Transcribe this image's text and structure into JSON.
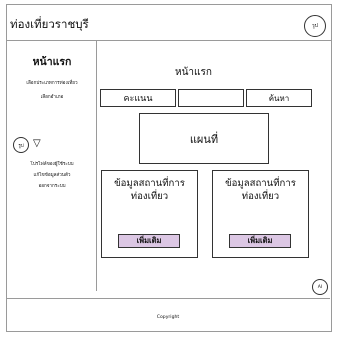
{
  "header": {
    "site_title": "ท่องเที่ยวราชบุรี",
    "avatar_label": "รูป"
  },
  "sidebar": {
    "title": "หน้าแรก",
    "lines": [
      "เลือกประเภทการท่องเที่ยว",
      "เลือกอำเภอ"
    ],
    "avatar_label": "รูป",
    "menu": [
      "โปรไฟล์ของผู้ใช้ระบบ",
      "แก้ไขข้อมูลส่วนตัว",
      "ออกจากระบบ"
    ]
  },
  "main": {
    "title": "หน้าแรก",
    "score_label": "คะแนน",
    "search_value": "",
    "search_button": "ค้นหา",
    "map_label": "แผนที่",
    "cards": [
      {
        "title_line1": "ข้อมูลสถานที่การ",
        "title_line2": "ท่องเที่ยว",
        "button": "เพิ่มเติม"
      },
      {
        "title_line1": "ข้อมูลสถานที่การ",
        "title_line2": "ท่องเที่ยว",
        "button": "เพิ่มเติม"
      }
    ],
    "chat_label": "AI"
  },
  "footer": {
    "copyright": "Copyright"
  }
}
